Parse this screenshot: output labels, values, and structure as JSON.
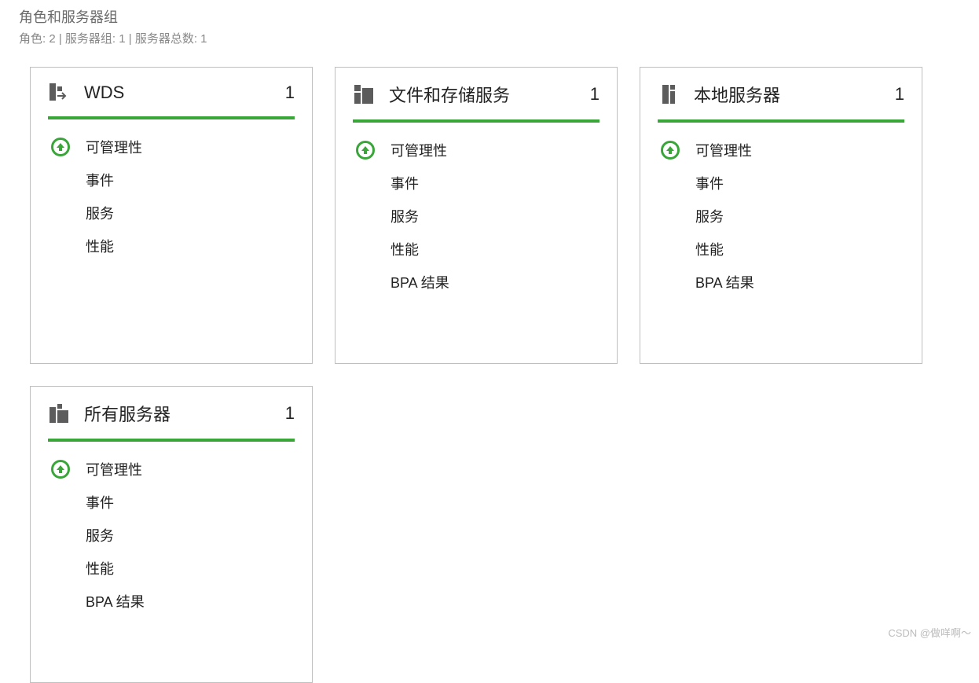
{
  "header": {
    "title": "角色和服务器组",
    "summary": "角色: 2 | 服务器组: 1 | 服务器总数: 1"
  },
  "tiles": [
    {
      "icon": "wds",
      "title": "WDS",
      "count": "1",
      "status_label": "可管理性",
      "items": [
        "事件",
        "服务",
        "性能"
      ]
    },
    {
      "icon": "file-storage",
      "title": "文件和存储服务",
      "count": "1",
      "status_label": "可管理性",
      "items": [
        "事件",
        "服务",
        "性能",
        "BPA 结果"
      ]
    },
    {
      "icon": "local-server",
      "title": "本地服务器",
      "count": "1",
      "status_label": "可管理性",
      "items": [
        "事件",
        "服务",
        "性能",
        "BPA 结果"
      ]
    },
    {
      "icon": "all-servers",
      "title": "所有服务器",
      "count": "1",
      "status_label": "可管理性",
      "items": [
        "事件",
        "服务",
        "性能",
        "BPA 结果"
      ]
    }
  ],
  "watermark": "CSDN @做咩啊～",
  "colors": {
    "green": "#3aa63a",
    "border": "#bfbfbf",
    "icon_gray": "#5c5c5c"
  }
}
